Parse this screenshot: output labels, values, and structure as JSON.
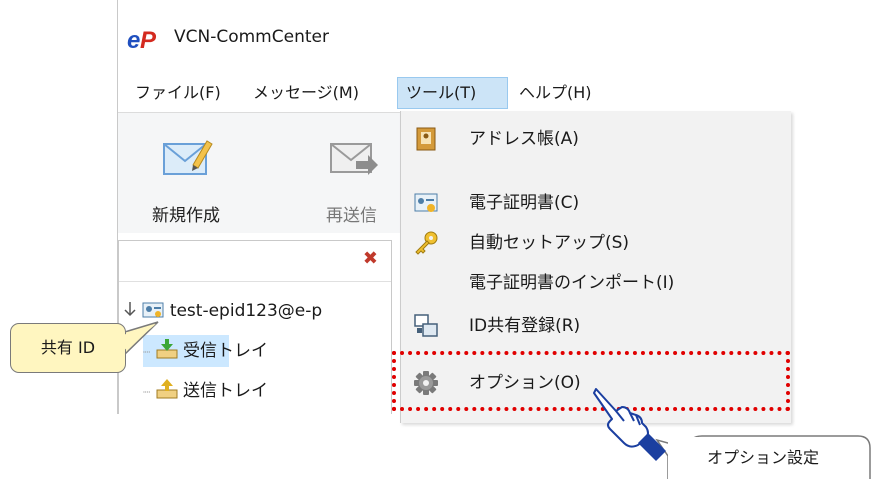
{
  "window": {
    "title": "VCN-CommCenter",
    "logo_text": "eP"
  },
  "menubar": [
    {
      "label": "ファイル(F)"
    },
    {
      "label": "メッセージ(M)"
    },
    {
      "label": "ツール(T)"
    },
    {
      "label": "ヘルプ(H)"
    }
  ],
  "toolbar": {
    "new_label": "新規作成",
    "resend_label": "再送信"
  },
  "tree": {
    "account": "test-epid123@e-p",
    "inbox": "受信トレイ",
    "outbox": "送信トレイ"
  },
  "tools_menu": [
    {
      "label": "アドレス帳(A)",
      "icon": "address-book-icon"
    },
    {
      "label": "電子証明書(C)",
      "icon": "certificate-icon"
    },
    {
      "label": "自動セットアップ(S)",
      "icon": "key-icon"
    },
    {
      "label": "電子証明書のインポート(I)",
      "icon": ""
    },
    {
      "label": "ID共有登録(R)",
      "icon": "shared-id-icon"
    },
    {
      "label": "オプション(O)",
      "icon": "gear-icon"
    }
  ],
  "annotations": {
    "shared_id": "共有 ID",
    "option_setting": "オプション設定"
  },
  "colors": {
    "highlight_border": "#e00000",
    "callout_fill": "#fff6c0",
    "menu_active": "#cce4f7",
    "selected_row": "#cce8ff"
  }
}
